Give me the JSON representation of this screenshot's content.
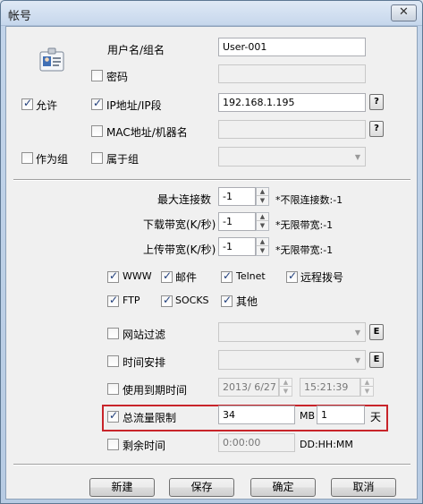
{
  "window": {
    "title": "帐号",
    "close_glyph": "✕"
  },
  "account": {
    "username_label": "用户名/组名",
    "username_value": "User-001",
    "password_label": "密码",
    "password_checked": false,
    "allow_label": "允许",
    "allow_checked": true,
    "ip_label": "IP地址/IP段",
    "ip_checked": true,
    "ip_value": "192.168.1.195",
    "ip_button": "?",
    "mac_label": "MAC地址/机器名",
    "mac_checked": false,
    "mac_button": "?",
    "as_group_label": "作为组",
    "as_group_checked": false,
    "belongs_label": "属于组",
    "belongs_checked": false
  },
  "limits": {
    "max_conn_label": "最大连接数",
    "max_conn_value": "-1",
    "max_conn_note": "*不限连接数:-1",
    "download_label": "下载带宽(K/秒)",
    "download_value": "-1",
    "download_note": "*无限带宽:-1",
    "upload_label": "上传带宽(K/秒)",
    "upload_value": "-1",
    "upload_note": "*无限带宽:-1"
  },
  "services": [
    {
      "label": "WWW",
      "checked": true
    },
    {
      "label": "邮件",
      "checked": true
    },
    {
      "label": "Telnet",
      "checked": true
    },
    {
      "label": "远程拨号",
      "checked": true
    },
    {
      "label": "FTP",
      "checked": true
    },
    {
      "label": "SOCKS",
      "checked": true
    },
    {
      "label": "其他",
      "checked": true
    }
  ],
  "filters": {
    "site_filter_label": "网站过滤",
    "site_filter_checked": false,
    "site_filter_button": "E",
    "schedule_label": "时间安排",
    "schedule_checked": false,
    "schedule_button": "E",
    "expiry_label": "使用到期时间",
    "expiry_checked": false,
    "expiry_date": "2013/ 6/27",
    "expiry_time": "15:21:39",
    "traffic_label": "总流量限制",
    "traffic_checked": true,
    "traffic_value": "34",
    "traffic_unit": "MB",
    "traffic_days": "1",
    "traffic_days_unit": "天",
    "remaining_label": "剩余时间",
    "remaining_checked": false,
    "remaining_value": "0:00:00",
    "remaining_format": "DD:HH:MM"
  },
  "buttons": {
    "new": "新建",
    "save": "保存",
    "ok": "确定",
    "cancel": "取消"
  },
  "colors": {
    "highlight": "#c8242a",
    "titlebar": "#c6d7ec"
  }
}
